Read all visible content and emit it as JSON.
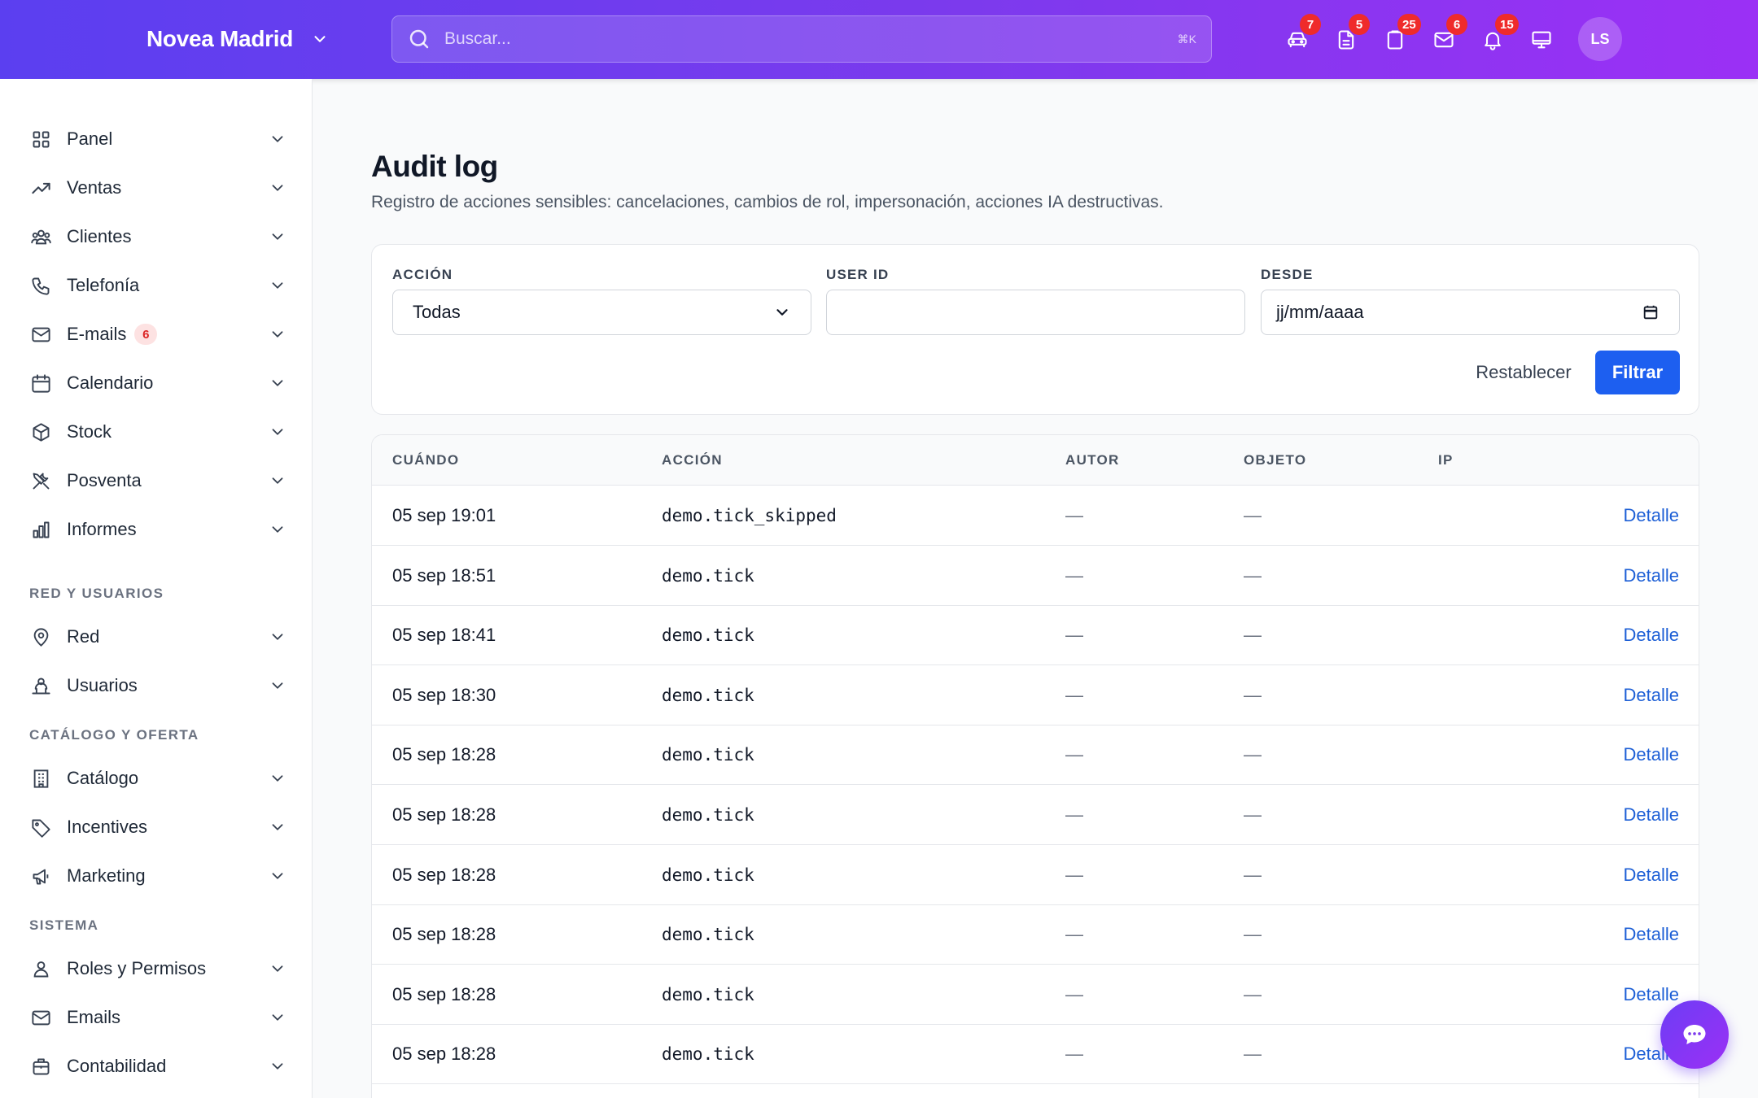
{
  "header": {
    "brand": "Novea Madrid",
    "search_placeholder": "Buscar...",
    "shortcut": "⌘K",
    "icons": [
      {
        "name": "car-icon",
        "badge": "7"
      },
      {
        "name": "document-icon",
        "badge": "5"
      },
      {
        "name": "clipboard-icon",
        "badge": "25"
      },
      {
        "name": "mail-icon",
        "badge": "6"
      },
      {
        "name": "bell-icon",
        "badge": "15"
      },
      {
        "name": "monitor-icon",
        "badge": ""
      }
    ],
    "avatar_initials": "LS"
  },
  "sidebar": {
    "main_items": [
      {
        "label": "Panel",
        "icon": "grid-icon"
      },
      {
        "label": "Ventas",
        "icon": "trending-up-icon"
      },
      {
        "label": "Clientes",
        "icon": "users-icon"
      },
      {
        "label": "Telefonía",
        "icon": "phone-icon"
      },
      {
        "label": "E-mails",
        "icon": "mail-icon",
        "badge": "6"
      },
      {
        "label": "Calendario",
        "icon": "calendar-icon"
      },
      {
        "label": "Stock",
        "icon": "box-icon"
      },
      {
        "label": "Posventa",
        "icon": "tools-icon"
      },
      {
        "label": "Informes",
        "icon": "bar-chart-icon"
      }
    ],
    "section_red": "RED Y USUARIOS",
    "red_items": [
      {
        "label": "Red",
        "icon": "map-pin-icon"
      },
      {
        "label": "Usuarios",
        "icon": "user-group-icon"
      }
    ],
    "section_catalogo": "CATÁLOGO Y OFERTA",
    "catalogo_items": [
      {
        "label": "Catálogo",
        "icon": "building-icon"
      },
      {
        "label": "Incentives",
        "icon": "tag-icon"
      },
      {
        "label": "Marketing",
        "icon": "megaphone-icon"
      }
    ],
    "section_sistema": "SISTEMA",
    "sistema_items": [
      {
        "label": "Roles y Permisos",
        "icon": "user-icon"
      },
      {
        "label": "Emails",
        "icon": "mail-icon"
      },
      {
        "label": "Contabilidad",
        "icon": "briefcase-icon"
      }
    ]
  },
  "page": {
    "title": "Audit log",
    "subtitle": "Registro de acciones sensibles: cancelaciones, cambios de rol, impersonación, acciones IA destructivas."
  },
  "filters": {
    "accion_label": "ACCIÓN",
    "accion_value": "Todas",
    "userid_label": "USER ID",
    "userid_value": "",
    "desde_label": "DESDE",
    "desde_value": "jj/mm/aaaa",
    "reset_label": "Restablecer",
    "filter_label": "Filtrar"
  },
  "table": {
    "columns": [
      "CUÁNDO",
      "ACCIÓN",
      "AUTOR",
      "OBJETO",
      "IP"
    ],
    "detail_label": "Detalle",
    "rows": [
      {
        "when": "05 sep 19:01",
        "action": "demo.tick_skipped",
        "author": "—",
        "object": "—",
        "ip": ""
      },
      {
        "when": "05 sep 18:51",
        "action": "demo.tick",
        "author": "—",
        "object": "—",
        "ip": ""
      },
      {
        "when": "05 sep 18:41",
        "action": "demo.tick",
        "author": "—",
        "object": "—",
        "ip": ""
      },
      {
        "when": "05 sep 18:30",
        "action": "demo.tick",
        "author": "—",
        "object": "—",
        "ip": ""
      },
      {
        "when": "05 sep 18:28",
        "action": "demo.tick",
        "author": "—",
        "object": "—",
        "ip": ""
      },
      {
        "when": "05 sep 18:28",
        "action": "demo.tick",
        "author": "—",
        "object": "—",
        "ip": ""
      },
      {
        "when": "05 sep 18:28",
        "action": "demo.tick",
        "author": "—",
        "object": "—",
        "ip": ""
      },
      {
        "when": "05 sep 18:28",
        "action": "demo.tick",
        "author": "—",
        "object": "—",
        "ip": ""
      },
      {
        "when": "05 sep 18:28",
        "action": "demo.tick",
        "author": "—",
        "object": "—",
        "ip": ""
      },
      {
        "when": "05 sep 18:28",
        "action": "demo.tick",
        "author": "—",
        "object": "—",
        "ip": ""
      }
    ]
  },
  "chat_icon": "chat-icon",
  "colors": {
    "accent": "#1d5ff0",
    "header_start": "#5b3ff0",
    "header_end": "#9b30f5",
    "badge": "#ef2b2b"
  }
}
